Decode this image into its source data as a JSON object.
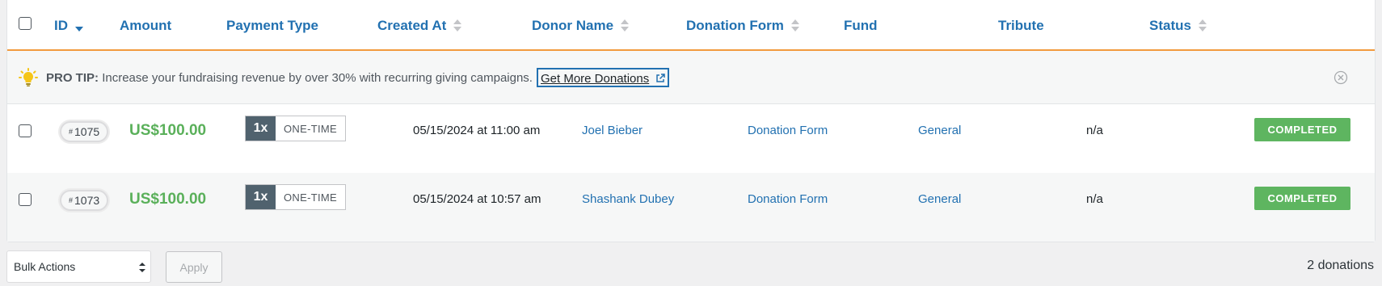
{
  "table": {
    "columns": {
      "id": "ID",
      "amount": "Amount",
      "payment_type": "Payment Type",
      "created_at": "Created At",
      "donor_name": "Donor Name",
      "donation_form": "Donation Form",
      "fund": "Fund",
      "tribute": "Tribute",
      "status": "Status"
    },
    "sort": {
      "active_column": "ID",
      "direction": "descending"
    },
    "rows": [
      {
        "id": "1075",
        "amount": "US$100.00",
        "frequency": "1x",
        "payment_label": "ONE-TIME",
        "created_at": "05/15/2024 at 11:00 am",
        "donor_name": "Joel Bieber",
        "donation_form": "Donation Form",
        "fund": "General",
        "tribute": "n/a",
        "status": "COMPLETED"
      },
      {
        "id": "1073",
        "amount": "US$100.00",
        "frequency": "1x",
        "payment_label": "ONE-TIME",
        "created_at": "05/15/2024 at 10:57 am",
        "donor_name": "Shashank Dubey",
        "donation_form": "Donation Form",
        "fund": "General",
        "tribute": "n/a",
        "status": "COMPLETED"
      }
    ]
  },
  "pro_tip": {
    "prefix": "PRO TIP:",
    "message": "Increase your fundraising revenue by over 30% with recurring giving campaigns.",
    "cta_label": "Get More Donations",
    "icon": "lightbulb-icon"
  },
  "footer": {
    "bulk_actions_label": "Bulk Actions",
    "apply_label": "Apply",
    "count_label": "2 donations"
  },
  "colors": {
    "accent": "#2271b1",
    "header_border": "#f29b3e",
    "amount": "#5ab05a",
    "status_completed": "#5eb560",
    "frequency_badge": "#50626e"
  }
}
